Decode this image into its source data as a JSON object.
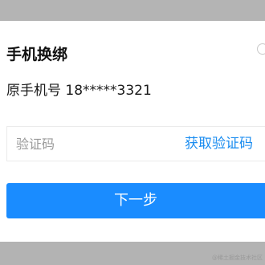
{
  "dialog": {
    "title": "手机换绑",
    "original_phone": "原手机号 18*****3321",
    "code_input_placeholder": "验证码",
    "code_input_value": "",
    "get_code_label": "获取验证码",
    "next_label": "下一步"
  },
  "watermark": "@稀土掘金技术社区",
  "icons": {
    "close": "close-icon"
  },
  "colors": {
    "accent": "#1a8cff",
    "link": "#1a8cf0",
    "overlay": "#b3b3b3",
    "dialog_background": "#ffffff"
  }
}
